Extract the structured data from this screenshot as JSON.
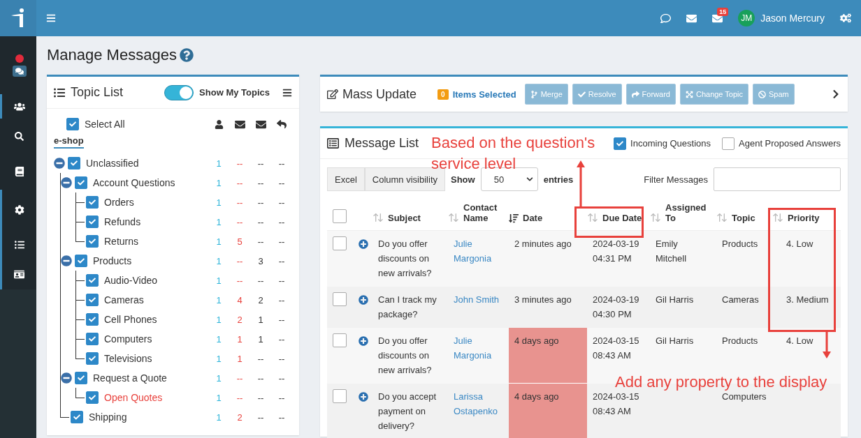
{
  "topbar": {
    "notification_count": "15",
    "user": {
      "initials": "JM",
      "name": "Jason Mercury"
    }
  },
  "sidebar": {
    "items": [
      {
        "kind": "chat",
        "selected": false
      },
      {
        "kind": "users",
        "selected": true
      },
      {
        "kind": "search",
        "selected": false
      },
      {
        "kind": "knowledge",
        "selected": false
      },
      {
        "kind": "list-settings",
        "selected": true
      },
      {
        "kind": "list",
        "selected": true
      },
      {
        "kind": "card",
        "selected": true
      }
    ]
  },
  "page": {
    "title": "Manage Messages"
  },
  "topic_list": {
    "title": "Topic List",
    "show_my_topics": {
      "label": "Show My Topics",
      "on": true
    },
    "select_all": {
      "label": "Select All",
      "checked": true
    },
    "group": "e-shop",
    "topics": [
      {
        "label": "Unclassified",
        "checked": true,
        "expanded": true,
        "alert": false,
        "counts": [
          "1",
          "--",
          "--",
          "--"
        ],
        "children": [
          {
            "label": "Account Questions",
            "checked": true,
            "expanded": true,
            "alert": false,
            "counts": [
              "1",
              "--",
              "--",
              "--"
            ],
            "children": [
              {
                "label": "Orders",
                "checked": true,
                "alert": false,
                "counts": [
                  "1",
                  "--",
                  "--",
                  "--"
                ]
              },
              {
                "label": "Refunds",
                "checked": true,
                "alert": false,
                "counts": [
                  "1",
                  "--",
                  "--",
                  "--"
                ]
              },
              {
                "label": "Returns",
                "checked": true,
                "alert": false,
                "counts": [
                  "1",
                  "5",
                  "--",
                  "--"
                ]
              }
            ]
          },
          {
            "label": "Products",
            "checked": true,
            "expanded": true,
            "alert": false,
            "counts": [
              "1",
              "--",
              "3",
              "--"
            ],
            "children": [
              {
                "label": "Audio-Video",
                "checked": true,
                "alert": false,
                "counts": [
                  "1",
                  "--",
                  "--",
                  "--"
                ]
              },
              {
                "label": "Cameras",
                "checked": true,
                "alert": false,
                "counts": [
                  "1",
                  "4",
                  "2",
                  "--"
                ]
              },
              {
                "label": "Cell Phones",
                "checked": true,
                "alert": false,
                "counts": [
                  "1",
                  "2",
                  "1",
                  "--"
                ]
              },
              {
                "label": "Computers",
                "checked": true,
                "alert": false,
                "counts": [
                  "1",
                  "1",
                  "1",
                  "--"
                ]
              },
              {
                "label": "Televisions",
                "checked": true,
                "alert": false,
                "counts": [
                  "1",
                  "1",
                  "--",
                  "--"
                ]
              }
            ]
          },
          {
            "label": "Request a Quote",
            "checked": true,
            "expanded": true,
            "alert": false,
            "counts": [
              "1",
              "--",
              "--",
              "--"
            ],
            "children": [
              {
                "label": "Open Quotes",
                "checked": true,
                "alert": true,
                "counts": [
                  "1",
                  "--",
                  "--",
                  "--"
                ]
              }
            ]
          },
          {
            "label": "Shipping",
            "checked": true,
            "alert": false,
            "counts": [
              "1",
              "2",
              "--",
              "--"
            ]
          }
        ]
      }
    ]
  },
  "mass_update": {
    "title": "Mass Update",
    "selected_count": "0",
    "selected_label": "Items Selected",
    "buttons": [
      {
        "label": "Merge",
        "kind": "merge",
        "disabled": true
      },
      {
        "label": "Resolve",
        "kind": "resolve",
        "disabled": true
      },
      {
        "label": "Forward",
        "kind": "forward",
        "disabled": true
      },
      {
        "label": "Change Topic",
        "kind": "change-topic",
        "disabled": true
      },
      {
        "label": "Spam",
        "kind": "spam",
        "disabled": true
      }
    ]
  },
  "message_list": {
    "title": "Message List",
    "filters": [
      {
        "label": "Incoming Questions",
        "checked": true
      },
      {
        "label": "Agent Proposed Answers",
        "checked": false
      }
    ],
    "export_buttons": [
      "Excel",
      "Column visibility"
    ],
    "show_label": "Show",
    "page_size": "50",
    "entries_label": "entries",
    "search_label": "Filter Messages",
    "select_all_checked": false,
    "columns": [
      {
        "label": "Subject",
        "sorted": false
      },
      {
        "label": "Contact Name",
        "sorted": false
      },
      {
        "label": "Date",
        "sorted": true
      },
      {
        "label": "Due Date",
        "sorted": false
      },
      {
        "label": "Assigned To",
        "sorted": false
      },
      {
        "label": "Topic",
        "sorted": false
      },
      {
        "label": "Priority",
        "sorted": false
      }
    ],
    "rows": [
      {
        "checked": false,
        "subject": "Do you offer discounts on new arrivals?",
        "contact": "Julie Margonia",
        "date": "2 minutes ago",
        "overdue": false,
        "due": "2024-03-19 04:31 PM",
        "assigned": "Emily Mitchell",
        "topic": "Products",
        "priority": "4. Low"
      },
      {
        "checked": false,
        "subject": "Can I track my package?",
        "contact": "John Smith",
        "date": "3 minutes ago",
        "overdue": false,
        "due": "2024-03-19 04:30 PM",
        "assigned": "Gil Harris",
        "topic": "Cameras",
        "priority": "3. Medium"
      },
      {
        "checked": false,
        "subject": "Do you offer discounts on new arrivals?",
        "contact": "Julie Margonia",
        "date": "4 days ago",
        "overdue": true,
        "due": "2024-03-15 08:43 AM",
        "assigned": "Gil Harris",
        "topic": "Products",
        "priority": "4. Low"
      },
      {
        "checked": false,
        "subject": "Do you accept payment on delivery?",
        "contact": "Larissa Ostapenko",
        "date": "4 days ago",
        "overdue": true,
        "due": "2024-03-15 08:43 AM",
        "assigned": "",
        "topic": "Computers",
        "priority": ""
      }
    ]
  },
  "annotations": [
    {
      "text": "Based on the question's service level"
    },
    {
      "text": "Add any property to the display"
    }
  ]
}
